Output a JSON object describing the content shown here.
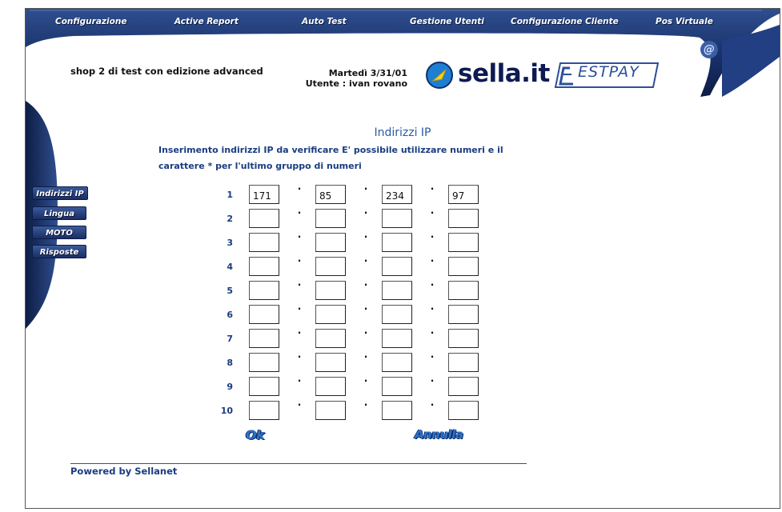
{
  "nav": {
    "items": [
      {
        "label": "Configurazione"
      },
      {
        "label": "Active Report"
      },
      {
        "label": "Auto Test"
      },
      {
        "label": "Gestione Utenti"
      },
      {
        "label": "Configurazione Cliente"
      },
      {
        "label": "Pos Virtuale"
      }
    ]
  },
  "header": {
    "shop_name": "shop 2 di test con edizione advanced",
    "date": "Martedì 3/31/01",
    "user": "Utente : ivan rovano",
    "sella_logo": "sella.it",
    "gestpay_logo": "ESTPAY",
    "at_symbol": "@"
  },
  "sidebar": {
    "items": [
      {
        "label": "Indirizzi IP"
      },
      {
        "label": "Lingua"
      },
      {
        "label": "MOTO"
      },
      {
        "label": "Risposte"
      }
    ]
  },
  "main": {
    "title": "Indirizzi IP",
    "instructions": "Inserimento indirizzi IP da verificare E' possibile utilizzare numeri e il carattere * per l'ultimo gruppo di numeri",
    "dot": "·",
    "rows": [
      {
        "num": "1",
        "octets": [
          "171",
          "85",
          "234",
          "97"
        ]
      },
      {
        "num": "2",
        "octets": [
          "",
          "",
          "",
          ""
        ]
      },
      {
        "num": "3",
        "octets": [
          "",
          "",
          "",
          ""
        ]
      },
      {
        "num": "4",
        "octets": [
          "",
          "",
          "",
          ""
        ]
      },
      {
        "num": "5",
        "octets": [
          "",
          "",
          "",
          ""
        ]
      },
      {
        "num": "6",
        "octets": [
          "",
          "",
          "",
          ""
        ]
      },
      {
        "num": "7",
        "octets": [
          "",
          "",
          "",
          ""
        ]
      },
      {
        "num": "8",
        "octets": [
          "",
          "",
          "",
          ""
        ]
      },
      {
        "num": "9",
        "octets": [
          "",
          "",
          "",
          ""
        ]
      },
      {
        "num": "10",
        "octets": [
          "",
          "",
          "",
          ""
        ]
      }
    ],
    "ok_label": "Ok",
    "cancel_label": "Annulla"
  },
  "footer": {
    "powered_by": "Powered by Sellanet"
  },
  "colors": {
    "nav_dark": "#13255a",
    "accent_blue": "#2b5aa1",
    "text_blue": "#1a3c80"
  }
}
